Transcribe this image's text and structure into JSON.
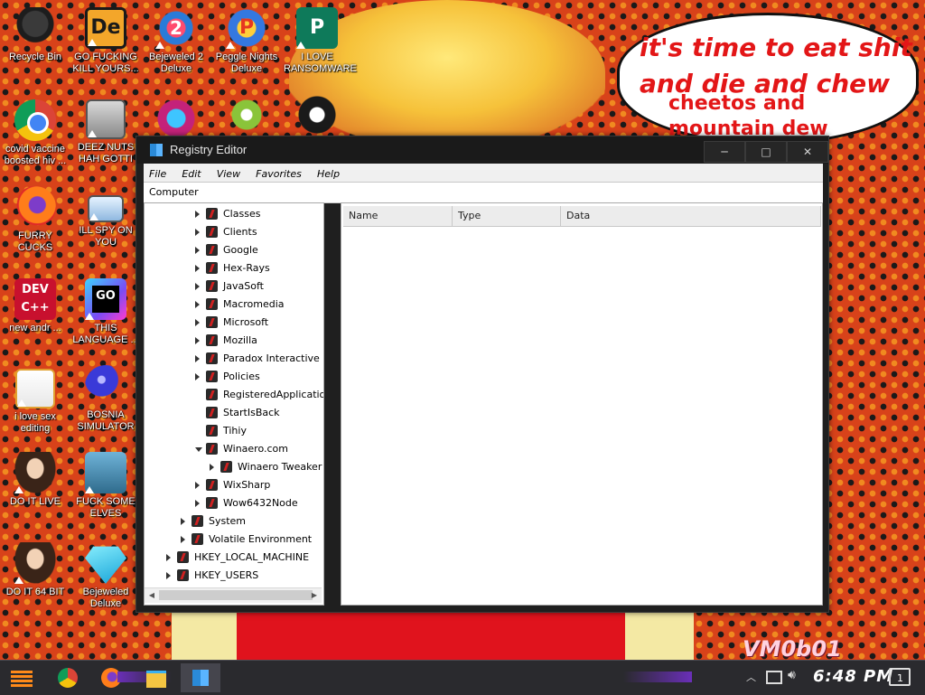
{
  "desktop": {
    "speech_bubble": {
      "line1": "it's time to eat shit",
      "line2": "and die and chew",
      "line3": "cheetos and",
      "line4": "mountain dew"
    },
    "watermark": "VM0b01",
    "icons": [
      {
        "label": "Recycle Bin",
        "icon": "recycle-bin-icon"
      },
      {
        "label": "GO FUCKING KILL YOURS...",
        "icon": "adobe-de-icon"
      },
      {
        "label": "Bejeweled 2 Deluxe",
        "icon": "bejeweled-2-icon"
      },
      {
        "label": "Peggle Nights Deluxe",
        "icon": "peggle-icon"
      },
      {
        "label": "I LOVE RANSOMWARE",
        "icon": "publisher-icon"
      },
      {
        "label": "covid vaccine boosted hiv ...",
        "icon": "chrome-icon"
      },
      {
        "label": "DEEZ NUTS HAH GOTTI",
        "icon": "windows-copy-icon"
      },
      {
        "label": "FURRY CUCKS",
        "icon": "firefox-icon"
      },
      {
        "label": "ILL SPY ON YOU",
        "icon": "network-spy-icon"
      },
      {
        "label": "new andr ...",
        "icon": "dev-cpp-icon"
      },
      {
        "label": "THIS LANGUAGE ...",
        "icon": "goland-icon"
      },
      {
        "label": "i love sex editing",
        "icon": "editor-icon"
      },
      {
        "label": "BOSNIA SIMULATOR",
        "icon": "mine-icon"
      },
      {
        "label": "DO IT LIVE",
        "icon": "portrait-icon"
      },
      {
        "label": "FUCK SOME ELVES",
        "icon": "elf-icon"
      },
      {
        "label": "DO IT 64 BIT",
        "icon": "portrait-64-icon"
      },
      {
        "label": "Bejeweled Deluxe",
        "icon": "diamond-icon"
      }
    ]
  },
  "window": {
    "title": "Registry Editor",
    "minimize": "─",
    "maximize": "□",
    "close": "✕",
    "menu": [
      "File",
      "Edit",
      "View",
      "Favorites",
      "Help"
    ],
    "address": "Computer",
    "tree": [
      {
        "label": "Classes",
        "expander": "collapsed"
      },
      {
        "label": "Clients",
        "expander": "collapsed"
      },
      {
        "label": "Google",
        "expander": "collapsed"
      },
      {
        "label": "Hex-Rays",
        "expander": "collapsed"
      },
      {
        "label": "JavaSoft",
        "expander": "collapsed"
      },
      {
        "label": "Macromedia",
        "expander": "collapsed"
      },
      {
        "label": "Microsoft",
        "expander": "collapsed"
      },
      {
        "label": "Mozilla",
        "expander": "collapsed"
      },
      {
        "label": "Paradox Interactive",
        "expander": "collapsed"
      },
      {
        "label": "Policies",
        "expander": "collapsed"
      },
      {
        "label": "RegisteredApplicatio",
        "expander": "none"
      },
      {
        "label": "StartIsBack",
        "expander": "none"
      },
      {
        "label": "Tihiy",
        "expander": "none"
      },
      {
        "label": "Winaero.com",
        "expander": "expanded"
      },
      {
        "label": "Winaero Tweaker",
        "expander": "collapsed"
      },
      {
        "label": "WixSharp",
        "expander": "collapsed"
      },
      {
        "label": "Wow6432Node",
        "expander": "collapsed"
      },
      {
        "label": "System",
        "expander": "collapsed"
      },
      {
        "label": "Volatile Environment",
        "expander": "collapsed"
      },
      {
        "label": "HKEY_LOCAL_MACHINE",
        "expander": "collapsed"
      },
      {
        "label": "HKEY_USERS",
        "expander": "collapsed"
      }
    ],
    "columns": [
      "Name",
      "Type",
      "Data"
    ]
  },
  "taskbar": {
    "clock": "6:48 PM",
    "notification_count": "1"
  },
  "colors": {
    "desktop_bg": "#d8421a",
    "speech_text": "#e31617",
    "window_chrome": "#1f1f1f"
  }
}
